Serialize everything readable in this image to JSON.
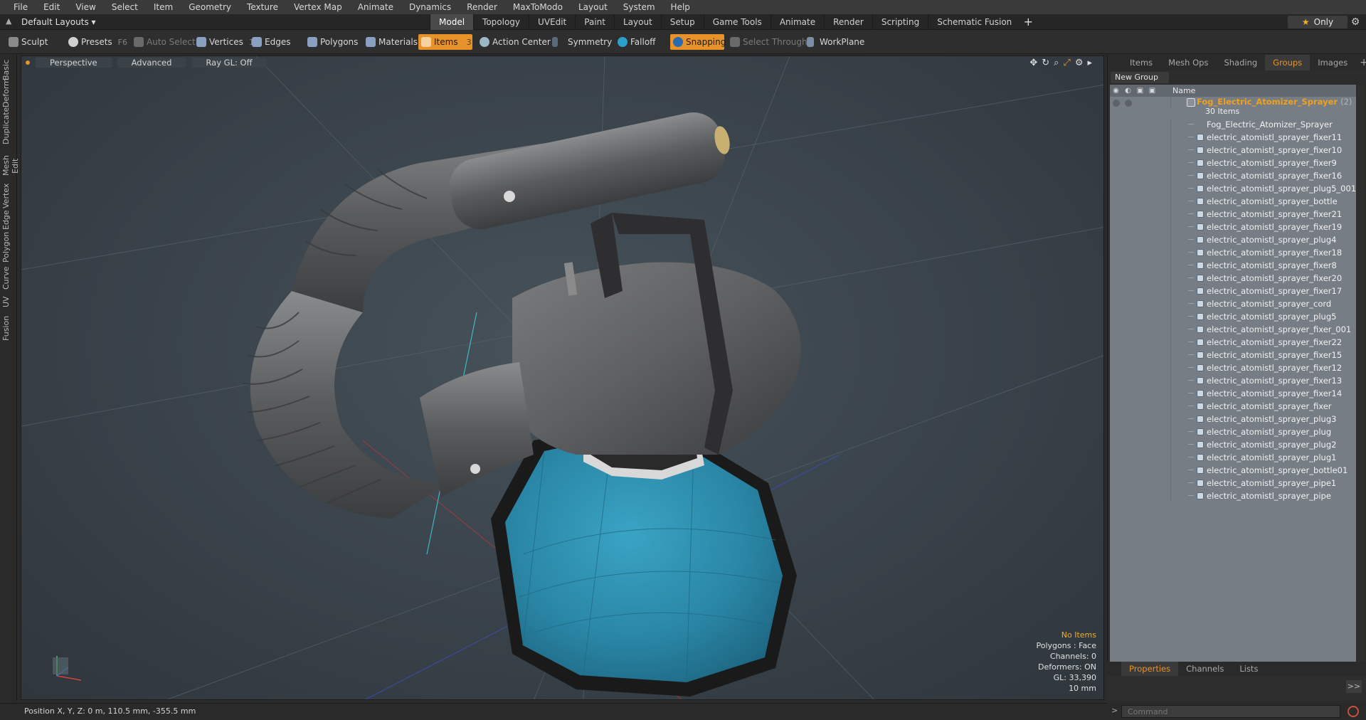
{
  "menu": [
    "File",
    "Edit",
    "View",
    "Select",
    "Item",
    "Geometry",
    "Texture",
    "Vertex Map",
    "Animate",
    "Dynamics",
    "Render",
    "MaxToModo",
    "Layout",
    "System",
    "Help"
  ],
  "layout": {
    "dropdown_label": "Default Layouts ▾",
    "tabs": [
      "Model",
      "Topology",
      "UVEdit",
      "Paint",
      "Layout",
      "Setup",
      "Game Tools",
      "Animate",
      "Render",
      "Scripting",
      "Schematic Fusion"
    ],
    "active_tab": "Model",
    "only_label": "Only"
  },
  "toolbar": {
    "sculpt": "Sculpt",
    "presets": "Presets",
    "presets_key": "F6",
    "auto_select": "Auto Select",
    "vertices": "Vertices",
    "vertices_count": "1",
    "edges": "Edges",
    "edges_count": "2",
    "polygons": "Polygons",
    "materials": "Materials",
    "items": "Items",
    "items_count": "3",
    "action_center": "Action Center",
    "symmetry": "Symmetry",
    "falloff": "Falloff",
    "snapping": "Snapping",
    "select_through": "Select Through",
    "workplane": "WorkPlane"
  },
  "left_tabs": [
    "Basic",
    "Deform",
    "Duplicate",
    "Mesh Edit",
    "Vertex",
    "Edge",
    "Polygon",
    "Curve",
    "UV",
    "Fusion"
  ],
  "viewport": {
    "view": "Perspective",
    "shading": "Advanced",
    "raygl": "Ray GL: Off",
    "stats": {
      "no_items": "No Items",
      "polygons": "Polygons : Face",
      "channels": "Channels: 0",
      "deformers": "Deformers: ON",
      "gl": "GL: 33,390",
      "scale": "10 mm"
    },
    "colors": {
      "body": "#5e5f61",
      "bottle": "#2a86a6",
      "background": "#3d464d"
    }
  },
  "panel": {
    "tabs": [
      "Items",
      "Mesh Ops",
      "Shading",
      "Groups",
      "Images"
    ],
    "active_tab": "Groups",
    "new_group": "New Group",
    "column_name": "Name",
    "group_name": "Fog_Electric_Atomizer_Sprayer",
    "group_count": "(2)",
    "group_items": "30 Items",
    "items": [
      "Fog_Electric_Atomizer_Sprayer",
      "electric_atomistl_sprayer_fixer11",
      "electric_atomistl_sprayer_fixer10",
      "electric_atomistl_sprayer_fixer9",
      "electric_atomistl_sprayer_fixer16",
      "electric_atomistl_sprayer_plug5_001",
      "electric_atomistl_sprayer_bottle",
      "electric_atomistl_sprayer_fixer21",
      "electric_atomistl_sprayer_fixer19",
      "electric_atomistl_sprayer_plug4",
      "electric_atomistl_sprayer_fixer18",
      "electric_atomistl_sprayer_fixer8",
      "electric_atomistl_sprayer_fixer20",
      "electric_atomistl_sprayer_fixer17",
      "electric_atomistl_sprayer_cord",
      "electric_atomistl_sprayer_plug5",
      "electric_atomistl_sprayer_fixer_001",
      "electric_atomistl_sprayer_fixer22",
      "electric_atomistl_sprayer_fixer15",
      "electric_atomistl_sprayer_fixer12",
      "electric_atomistl_sprayer_fixer13",
      "electric_atomistl_sprayer_fixer14",
      "electric_atomistl_sprayer_fixer",
      "electric_atomistl_sprayer_plug3",
      "electric_atomistl_sprayer_plug",
      "electric_atomistl_sprayer_plug2",
      "electric_atomistl_sprayer_plug1",
      "electric_atomistl_sprayer_bottle01",
      "electric_atomistl_sprayer_pipe1",
      "electric_atomistl_sprayer_pipe"
    ]
  },
  "properties": {
    "tabs": [
      "Properties",
      "Channels",
      "Lists"
    ],
    "active_tab": "Properties",
    "expand": ">>"
  },
  "status": {
    "position": "Position X, Y, Z:   0 m, 110.5 mm, -355.5 mm"
  },
  "command": {
    "placeholder": "Command"
  },
  "accent_color": "#e8922a"
}
